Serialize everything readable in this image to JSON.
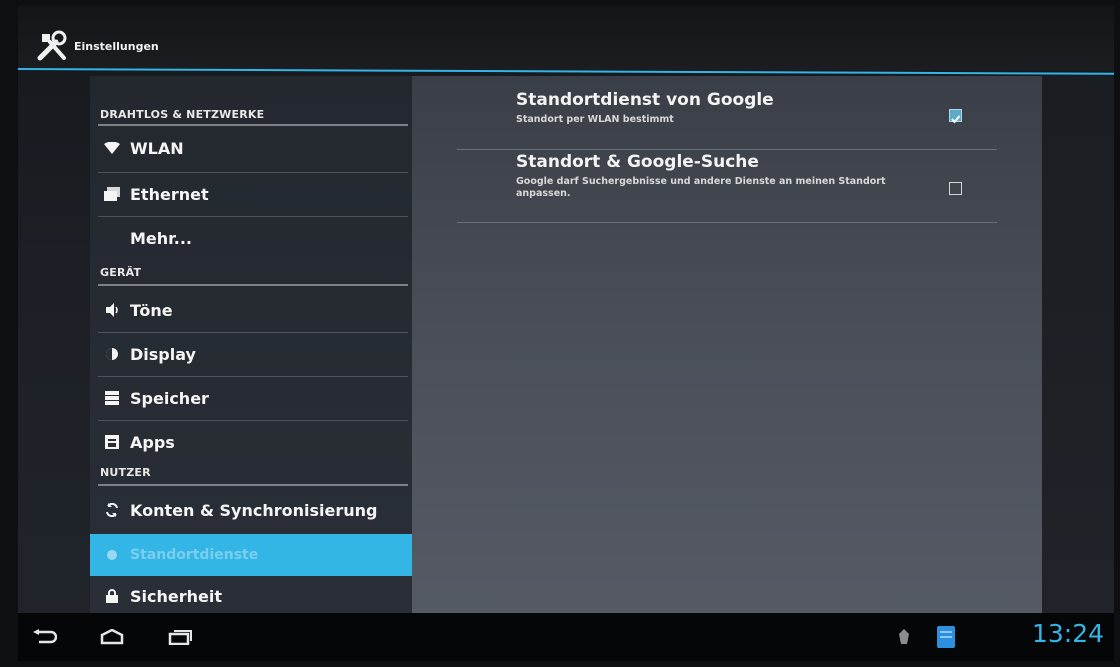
{
  "action_bar": {
    "title": "Einstellungen",
    "icon": "settings-tools-icon"
  },
  "sidebar": {
    "sections": [
      {
        "header": "DRAHTLOS & NETZWERKE"
      },
      {
        "header": "GERÄT"
      },
      {
        "header": "NUTZER"
      }
    ],
    "items": [
      {
        "label": "WLAN",
        "icon": "wifi-icon"
      },
      {
        "label": "Ethernet",
        "icon": "ethernet-icon"
      },
      {
        "label": "Mehr...",
        "icon": ""
      },
      {
        "label": "Töne",
        "icon": "sound-icon"
      },
      {
        "label": "Display",
        "icon": "display-icon"
      },
      {
        "label": "Speicher",
        "icon": "storage-icon"
      },
      {
        "label": "Apps",
        "icon": "apps-icon"
      },
      {
        "label": "Konten & Synchronisierung",
        "icon": "sync-icon"
      },
      {
        "label": "Standortdienste",
        "icon": "location-icon",
        "selected": true
      },
      {
        "label": "Sicherheit",
        "icon": "lock-icon"
      }
    ]
  },
  "main": {
    "preferences": [
      {
        "title": "Standortdienst von Google",
        "summary": "Standort per WLAN bestimmt",
        "checked": true
      },
      {
        "title": "Standort & Google-Suche",
        "summary": "Google darf Suchergebnisse und andere Dienste an meinen Standort anpassen.",
        "checked": false
      }
    ]
  },
  "system_bar": {
    "time": "13:24",
    "buttons": [
      "back-icon",
      "home-icon",
      "recent-apps-icon"
    ],
    "status_icons": [
      "android-debug-icon",
      "notification-icon"
    ]
  },
  "colors": {
    "accent": "#33b5e5",
    "panel_left": "#2a2f37",
    "panel_right": "#4a4f58"
  }
}
